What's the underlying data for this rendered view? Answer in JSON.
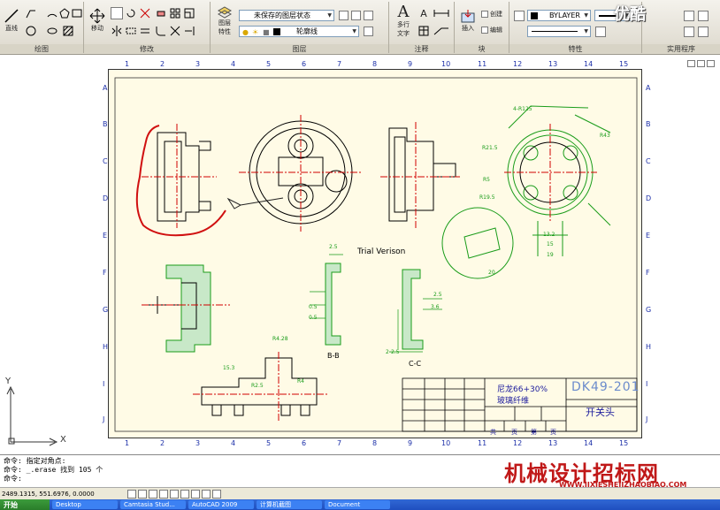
{
  "ribbon": {
    "panels": [
      {
        "title": "绘图",
        "draw_label": "直线"
      },
      {
        "title": "修改",
        "move_label": "移动"
      },
      {
        "title": "图层",
        "layer_props_label_1": "图层",
        "layer_props_label_2": "特性",
        "layer_state": "未保存的图层状态",
        "current_layer": "轮廓线"
      },
      {
        "title": "注释",
        "mtext_label_1": "多行",
        "mtext_label_2": "文字"
      },
      {
        "title": "块",
        "insert_label": "插入",
        "create_label": "创建",
        "edit_label": "编辑"
      },
      {
        "title": "特性",
        "color_value": "BYLAYER"
      },
      {
        "title": "实用程序"
      }
    ]
  },
  "drawing": {
    "top_ruler": [
      "1",
      "2",
      "3",
      "4",
      "5",
      "6",
      "7",
      "8",
      "9",
      "10",
      "11",
      "12",
      "13",
      "14",
      "15"
    ],
    "side_ruler": [
      "A",
      "B",
      "C",
      "D",
      "E",
      "F",
      "G",
      "H",
      "I",
      "J"
    ],
    "trial_text": "Trial Verison",
    "section_labels": [
      "B-B",
      "C-C"
    ],
    "title_block": {
      "material": "尼龙66+30%",
      "material_2": "玻璃纤维",
      "drawing_no": "DK49-201",
      "part_name": "开关头",
      "pages": [
        "共",
        "页",
        "第",
        "页"
      ]
    },
    "dims": [
      "R4.28",
      "15.3",
      "R2.5",
      "R4",
      "2.5",
      "0.5",
      "0.5",
      "3.6",
      "2.5",
      "2-2.5",
      "R21.5",
      "R19.5",
      "R5",
      "4-R125",
      "R43",
      "13.2",
      "15",
      "19",
      "20"
    ]
  },
  "ucs": {
    "y": "Y",
    "x": "X"
  },
  "command": {
    "lines": [
      "命令: 指定对角点:",
      "命令: _.erase 找到 105 个",
      "命令:"
    ]
  },
  "status": {
    "coords": "2489.1315, 551.6976, 0.0000"
  },
  "taskbar": {
    "start": "开始",
    "items": [
      "Desktop",
      "Camtasia Stud...",
      "AutoCAD 2009",
      "计算机截图",
      "Document"
    ]
  },
  "watermarks": {
    "top": "优酷",
    "brand": "机械设计招标网",
    "url": "WWW.JIXIESHEJIZHAOBIAO.COM"
  },
  "colors": {
    "sheet": "#fffbe6",
    "outline": "#000000",
    "centerline": "#d00000",
    "section": "#1a9c1a",
    "annotation": "#cc0000",
    "ruler": "#1c2fa8"
  }
}
